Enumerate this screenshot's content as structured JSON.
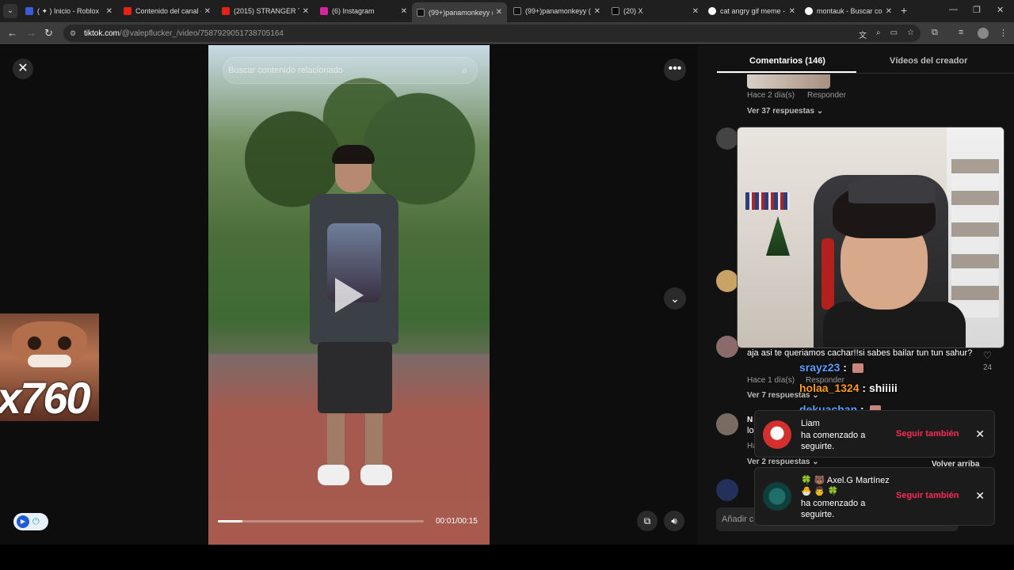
{
  "browser": {
    "tabs": [
      {
        "label": "( ✦ ) Inicio - Roblox",
        "color": "#3b5bdb"
      },
      {
        "label": "Contenido del canal - ",
        "color": "#e62117"
      },
      {
        "label": "(2015) STRANGER TH",
        "color": "#e62117"
      },
      {
        "label": "(6) Instagram",
        "color": "#d6249f"
      },
      {
        "label": "(99+)panamonkeyy (",
        "color": "#111111"
      },
      {
        "label": "(99+)panamonkeyy (",
        "color": "#111111"
      },
      {
        "label": "(20) X",
        "color": "#000000"
      },
      {
        "label": "cat angry gif meme -",
        "color": "#ffffff"
      },
      {
        "label": "montauk - Buscar co",
        "color": "#ffffff"
      }
    ],
    "address": {
      "host": "tiktok.com",
      "path": "/@valepflucker_/video/7587929051738705164"
    }
  },
  "video": {
    "search_placeholder": "Buscar contenido relacionado",
    "timecode": "00:01/00:15",
    "progress": 0.12
  },
  "meme_overlay": {
    "counter": "x760"
  },
  "comments_panel": {
    "tab_comments": "Comentarios (146)",
    "tab_creator_videos": "Vídeos del creador",
    "c1_time": "Hace 2 día(s)",
    "c1_reply": "Responder",
    "c1_view_replies": "Ver 37 respuestas ⌄",
    "c3_text": "aja asi te queriamos cachar!!si sabes bailar tun tun sahur?",
    "c3_time": "Hace 1 día(s)",
    "c3_reply": "Responder",
    "c3_likes": "24",
    "c3_view_replies": "Ver 7 respuestas ⌄",
    "c4_name": "N",
    "c4_text": "lo",
    "c4_time": "Ha",
    "c4_view_replies": "Ver 2 respuestas ⌄",
    "scroll_top": "Volver arriba",
    "add_comment_placeholder": "Añadir co"
  },
  "chat": [
    {
      "user": "srayz23",
      "message": "",
      "color": "#5aa0ff"
    },
    {
      "user": "holaa_1324",
      "message": "shiiiii",
      "color": "#ff9a1f"
    },
    {
      "user": "dekuachan",
      "message": "",
      "color": "#5aa0ff"
    }
  ],
  "notifications": [
    {
      "name": "Liam",
      "text": "ha comenzado a seguirte.",
      "action": "Seguir también"
    },
    {
      "name": "🍀 🐻 Axel.G Martínez🐣 👨 🍀",
      "text": "ha comenzado a seguirte.",
      "action": "Seguir también"
    }
  ]
}
